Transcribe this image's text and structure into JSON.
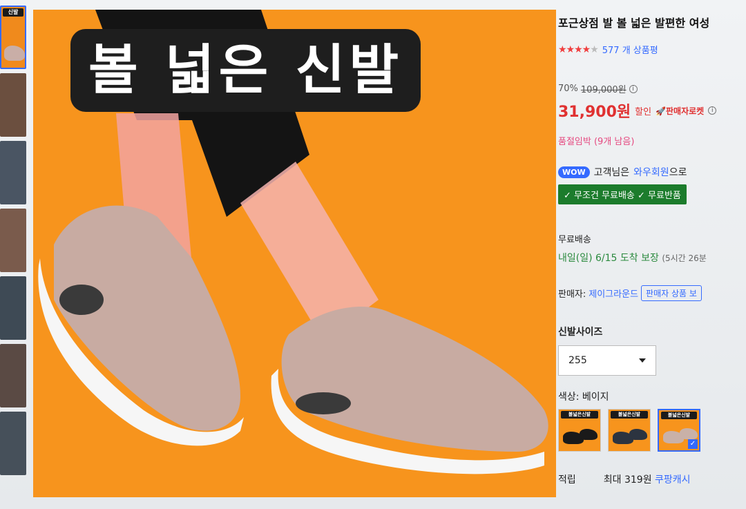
{
  "thumbnail_label": "신발",
  "image_overlay_title": "볼 넓은 신발",
  "product": {
    "title": "포근상점 발 볼 넓은 발편한 여성",
    "rating_stars": 4,
    "review_count": "577 개 상품평",
    "discount_rate": "70%",
    "original_price": "109,000원",
    "sale_price": "31,900원",
    "discount_label": "할인",
    "seller_rocket": "🚀판매자로켓",
    "stock_notice": "품절임박 (9개 남음)"
  },
  "wow": {
    "badge": "WOW",
    "text_prefix": "고객님은",
    "member_link": "와우회원",
    "text_suffix": "으로",
    "benefits": "✓ 무조건 무료배송 ✓ 무료반품"
  },
  "shipping": {
    "label": "무료배송",
    "date_text": "내일(일) 6/15 도착 보장",
    "time_text": "(5시간 26분"
  },
  "seller": {
    "label": "판매자:",
    "name": "제이그라운드",
    "products_button": "판매자 상품 보"
  },
  "size": {
    "label": "신발사이즈",
    "selected": "255"
  },
  "color": {
    "label": "색상: 베이지",
    "options": [
      {
        "label": "볼넓은신발",
        "shoe_color": "#1a1a1a"
      },
      {
        "label": "볼넓은신발",
        "shoe_color": "#2c3440"
      },
      {
        "label": "볼넓은신발",
        "shoe_color": "#c9b1a8"
      }
    ]
  },
  "points": {
    "label": "적립",
    "max_text": "최대 319원",
    "link": "쿠팡캐시"
  },
  "colors": {
    "accent_blue": "#346aff",
    "price_red": "#e03131",
    "image_orange": "#f7941d",
    "benefit_green": "#1c7c2c"
  }
}
